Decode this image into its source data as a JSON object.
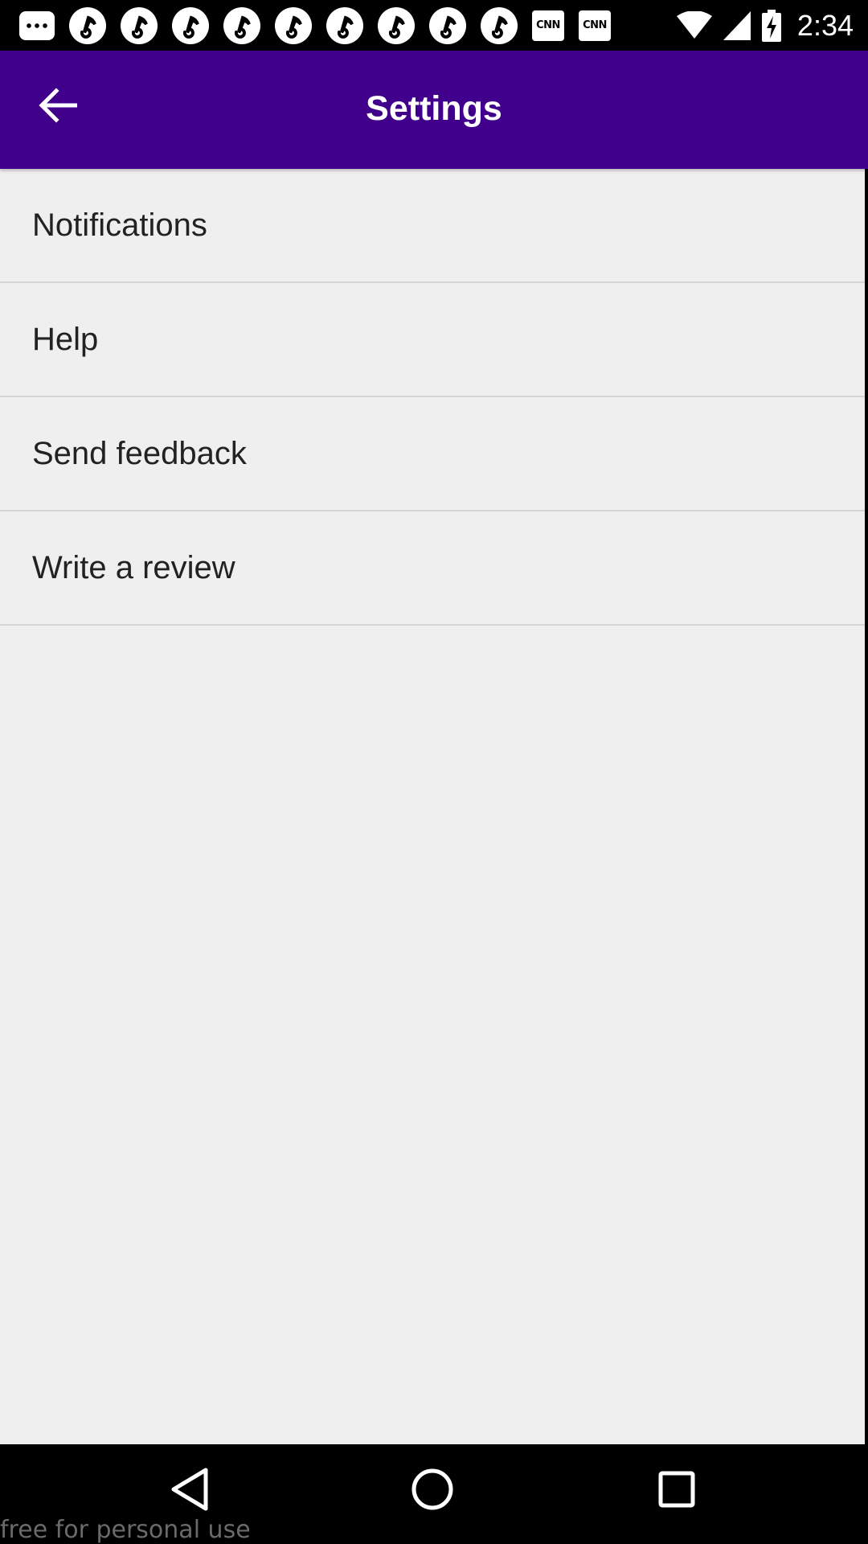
{
  "status_bar": {
    "notification_icons": [
      "chat-icon",
      "music-icon",
      "music-icon",
      "music-icon",
      "music-icon",
      "music-icon",
      "music-icon",
      "music-icon",
      "music-icon",
      "music-icon",
      "cnn-icon",
      "cnn-icon"
    ],
    "cnn_label": "CNN",
    "time": "2:34"
  },
  "app_bar": {
    "title": "Settings",
    "color": "#40008c"
  },
  "settings": {
    "items": [
      {
        "label": "Notifications"
      },
      {
        "label": "Help"
      },
      {
        "label": "Send feedback"
      },
      {
        "label": "Write a review"
      }
    ]
  },
  "nav_bar": {
    "buttons": [
      "back-icon",
      "home-icon",
      "recents-icon"
    ]
  },
  "watermark": "free for personal use"
}
